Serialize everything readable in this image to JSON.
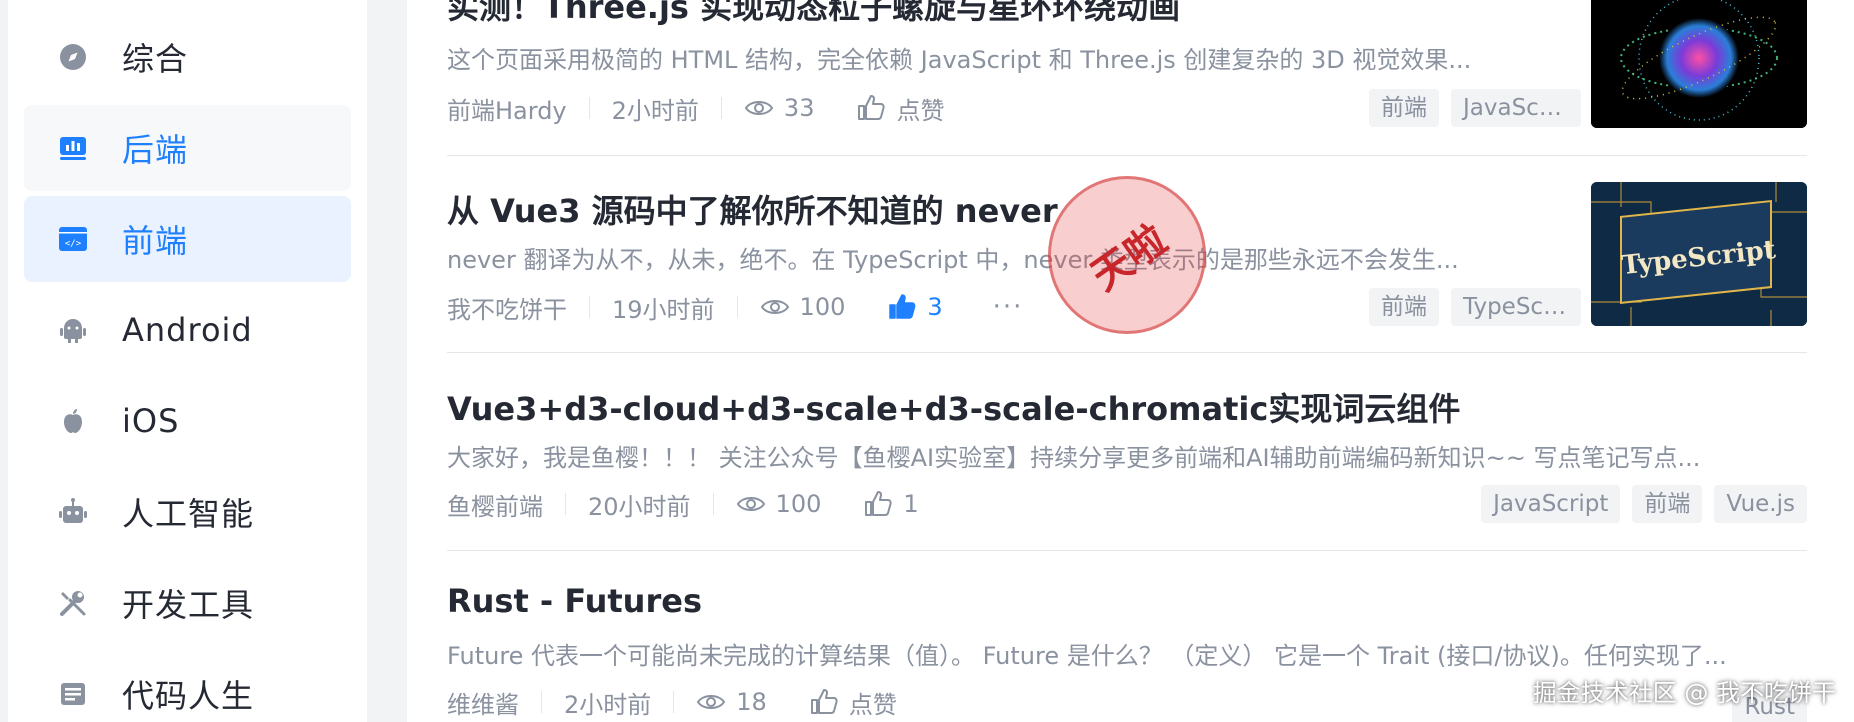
{
  "sidebar": {
    "items": [
      {
        "label": "综合",
        "icon": "compass-icon"
      },
      {
        "label": "后端",
        "icon": "chart-icon"
      },
      {
        "label": "前端",
        "icon": "code-window-icon"
      },
      {
        "label": "Android",
        "icon": "android-icon"
      },
      {
        "label": "iOS",
        "icon": "apple-icon"
      },
      {
        "label": "人工智能",
        "icon": "robot-icon"
      },
      {
        "label": "开发工具",
        "icon": "tools-icon"
      },
      {
        "label": "代码人生",
        "icon": "document-icon"
      }
    ]
  },
  "feed": {
    "entries": [
      {
        "title": "实测！Three.js 实现动态粒子螺旋与星环环绕动画",
        "abstract": "这个页面采用极简的 HTML 结构，完全依赖 JavaScript 和 Three.js 创建复杂的 3D 视觉效果...",
        "author": "前端Hardy",
        "time": "2小时前",
        "views": "33",
        "like": "点赞",
        "tags": [
          "前端",
          "JavaScript"
        ]
      },
      {
        "title": "从 Vue3 源码中了解你所不知道的 never",
        "abstract": "never 翻译为从不，从未，绝不。在 TypeScript 中，never 类型表示的是那些永远不会发生...",
        "author": "我不吃饼干",
        "time": "19小时前",
        "views": "100",
        "like": "3",
        "more": "···",
        "tags": [
          "前端",
          "TypeScript"
        ],
        "thumb_text": "TypeScript"
      },
      {
        "title": "Vue3+d3-cloud+d3-scale+d3-scale-chromatic实现词云组件",
        "abstract": "大家好，我是鱼樱！！！ 关注公众号【鱼樱AI实验室】持续分享更多前端和AI辅助前端编码新知识~~ 写点笔记写点...",
        "author": "鱼樱前端",
        "time": "20小时前",
        "views": "100",
        "like": "1",
        "tags": [
          "JavaScript",
          "前端",
          "Vue.js"
        ]
      },
      {
        "title": "Rust - Futures",
        "abstract": "Future 代表一个可能尚未完成的计算结果（值）。 Future 是什么？ （定义） 它是一个 Trait (接口/协议)。任何实现了...",
        "author": "维维酱",
        "time": "2小时前",
        "views": "18",
        "like": "点赞",
        "tags": [
          "Rust"
        ]
      }
    ]
  },
  "stamp": {
    "text": "天啦"
  },
  "watermark": "掘金技术社区 @ 我不吃饼干",
  "colors": {
    "accent": "#1e80ff",
    "stamp": "#c8262a"
  }
}
